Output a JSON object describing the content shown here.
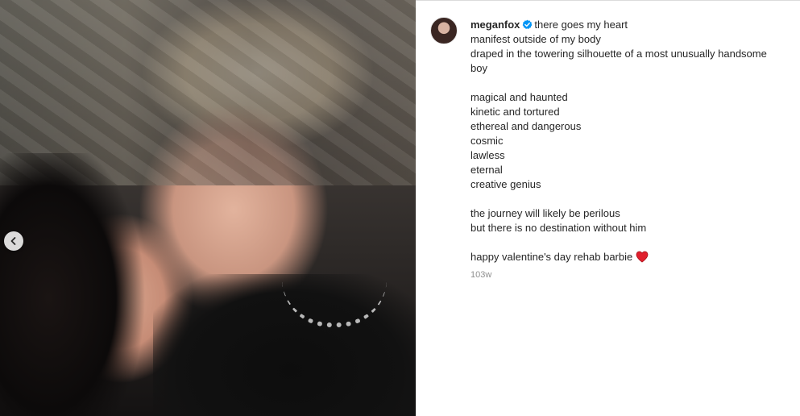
{
  "post": {
    "username": "meganfox",
    "caption_first": "there goes my heart",
    "caption_lines_1": [
      "manifest outside of my body",
      "draped in the towering silhouette of a most unusually handsome",
      "boy"
    ],
    "caption_lines_2": [
      "magical and haunted",
      "kinetic and tortured",
      "ethereal and dangerous",
      "cosmic",
      "lawless",
      "eternal",
      "creative genius"
    ],
    "caption_lines_3": [
      "the journey will likely be perilous",
      "but there is no destination without him"
    ],
    "caption_last": "happy valentine's day rehab barbie",
    "timestamp": "103w"
  },
  "icons": {
    "verified": "verified-badge-icon",
    "heart": "red-heart-emoji-icon",
    "prev": "chevron-left-icon"
  },
  "colors": {
    "verified_blue": "#0095f6",
    "heart_red": "#e0202d",
    "muted": "#8e8e8e",
    "text": "#262626"
  }
}
